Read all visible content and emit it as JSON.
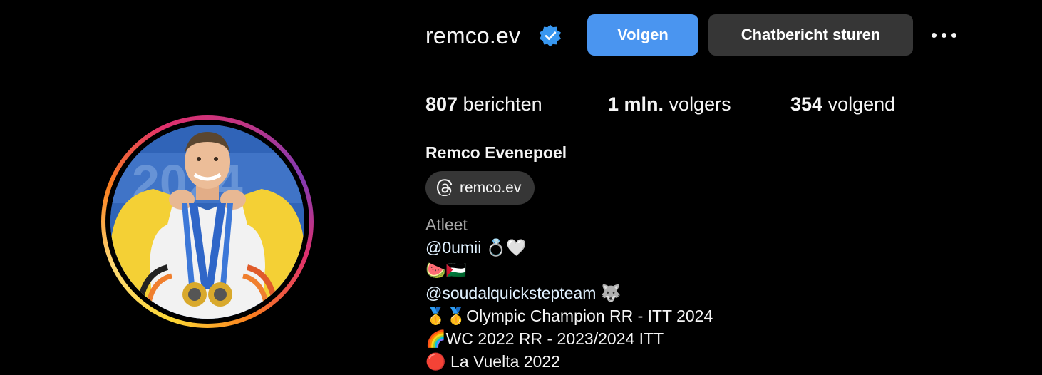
{
  "profile": {
    "username": "remco.ev",
    "verified_icon": "verified-badge-icon",
    "follow_label": "Volgen",
    "message_label": "Chatbericht sturen",
    "more_icon": "more-options-icon",
    "avatar_description_icon": "profile-photo"
  },
  "stats": {
    "posts_count": "807",
    "posts_label": "berichten",
    "followers_count": "1 mln.",
    "followers_label": "volgers",
    "following_count": "354",
    "following_label": "volgend"
  },
  "bio": {
    "full_name": "Remco Evenepoel",
    "threads_handle": "remco.ev",
    "threads_icon": "threads-icon",
    "category": "Atleet",
    "lines": [
      {
        "mention": "@0umii",
        "text": " 💍🤍"
      },
      {
        "text": "🍉🇵🇸"
      },
      {
        "mention": "@soudalquickstepteam",
        "text": " 🐺"
      },
      {
        "text": "🥇🥇Olympic Champion RR - ITT 2024"
      },
      {
        "text": "🌈WC 2022 RR - 2023/2024 ITT"
      },
      {
        "text": "🔴 La Vuelta 2022"
      }
    ]
  },
  "colors": {
    "background": "#000000",
    "follow_button": "#4a95f0",
    "message_button": "#363636",
    "verified_badge": "#3897f0",
    "secondary_text": "#a8a8a8"
  }
}
